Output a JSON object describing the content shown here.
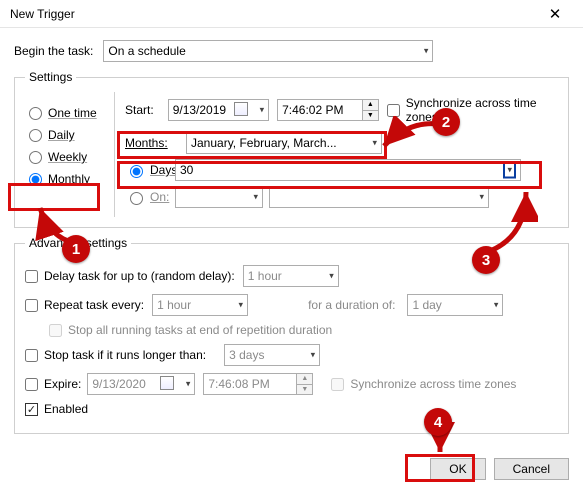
{
  "window": {
    "title": "New Trigger"
  },
  "begin": {
    "label": "Begin the task:",
    "value": "On a schedule"
  },
  "settings": {
    "legend": "Settings",
    "types": {
      "onetime": "One time",
      "daily": "Daily",
      "weekly": "Weekly",
      "monthly": "Monthly",
      "selected": "monthly"
    },
    "start": {
      "label": "Start:",
      "date": "9/13/2019",
      "time": "7:46:02 PM",
      "sync_label": "Synchronize across time zones"
    },
    "months": {
      "label": "Months:",
      "value": "January, February, March..."
    },
    "days": {
      "label": "Days:",
      "value": "30",
      "selected": true
    },
    "on": {
      "label": "On:",
      "value1": "",
      "value2": "",
      "selected": false
    }
  },
  "adv": {
    "legend": "Advanced settings",
    "delay": {
      "label": "Delay task for up to (random delay):",
      "value": "1 hour"
    },
    "repeat": {
      "label": "Repeat task every:",
      "value": "1 hour",
      "duration_label": "for a duration of:",
      "duration_value": "1 day"
    },
    "stopall": "Stop all running tasks at end of repetition duration",
    "stopif": {
      "label": "Stop task if it runs longer than:",
      "value": "3 days"
    },
    "expire": {
      "label": "Expire:",
      "date": "9/13/2020",
      "time": "7:46:08 PM",
      "sync_label": "Synchronize across time zones"
    },
    "enabled": {
      "label": "Enabled",
      "checked": true
    }
  },
  "buttons": {
    "ok": "OK",
    "cancel": "Cancel"
  },
  "annotations": {
    "b1": "1",
    "b2": "2",
    "b3": "3",
    "b4": "4"
  }
}
